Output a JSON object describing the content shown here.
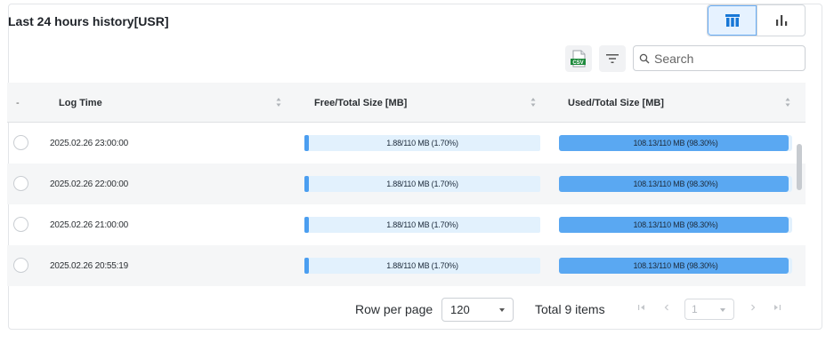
{
  "header": {
    "title": "Last 24 hours history[USR]"
  },
  "view_toggle": {
    "active": "table",
    "options": [
      "table-view-icon",
      "chart-view-icon"
    ]
  },
  "toolbar": {
    "csv_label": "CSV",
    "search_placeholder": "Search"
  },
  "table": {
    "columns": {
      "select": "-",
      "log_time": "Log Time",
      "free_total": "Free/Total Size [MB]",
      "used_total": "Used/Total Size [MB]"
    },
    "rows": [
      {
        "log_time": "2025.02.26 23:00:00",
        "free_label": "1.88/110 MB (1.70%)",
        "free_pct": 1.7,
        "used_label": "108.13/110 MB (98.30%)",
        "used_pct": 98.3
      },
      {
        "log_time": "2025.02.26 22:00:00",
        "free_label": "1.88/110 MB (1.70%)",
        "free_pct": 1.7,
        "used_label": "108.13/110 MB (98.30%)",
        "used_pct": 98.3
      },
      {
        "log_time": "2025.02.26 21:00:00",
        "free_label": "1.88/110 MB (1.70%)",
        "free_pct": 1.7,
        "used_label": "108.13/110 MB (98.30%)",
        "used_pct": 98.3
      },
      {
        "log_time": "2025.02.26 20:55:19",
        "free_label": "1.88/110 MB (1.70%)",
        "free_pct": 1.7,
        "used_label": "108.13/110 MB (98.30%)",
        "used_pct": 98.3
      }
    ]
  },
  "footer": {
    "rows_per_page_label": "Row per page",
    "rows_per_page_value": "120",
    "total_label": "Total 9 items",
    "current_page": "1"
  },
  "colors": {
    "accent": "#4b9ef0",
    "bar_track": "#e2f1fd",
    "csv_green": "#1e8a3c"
  }
}
